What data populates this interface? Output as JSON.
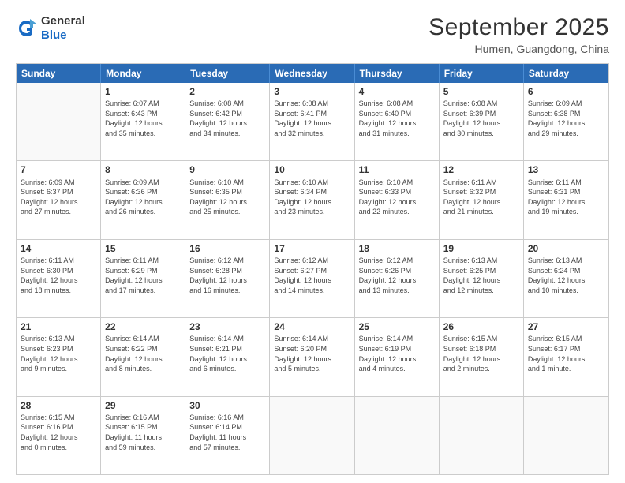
{
  "header": {
    "logo": {
      "general": "General",
      "blue": "Blue"
    },
    "title": "September 2025",
    "location": "Humen, Guangdong, China"
  },
  "calendar": {
    "weekdays": [
      "Sunday",
      "Monday",
      "Tuesday",
      "Wednesday",
      "Thursday",
      "Friday",
      "Saturday"
    ],
    "weeks": [
      [
        {
          "day": "",
          "info": ""
        },
        {
          "day": "1",
          "info": "Sunrise: 6:07 AM\nSunset: 6:43 PM\nDaylight: 12 hours\nand 35 minutes."
        },
        {
          "day": "2",
          "info": "Sunrise: 6:08 AM\nSunset: 6:42 PM\nDaylight: 12 hours\nand 34 minutes."
        },
        {
          "day": "3",
          "info": "Sunrise: 6:08 AM\nSunset: 6:41 PM\nDaylight: 12 hours\nand 32 minutes."
        },
        {
          "day": "4",
          "info": "Sunrise: 6:08 AM\nSunset: 6:40 PM\nDaylight: 12 hours\nand 31 minutes."
        },
        {
          "day": "5",
          "info": "Sunrise: 6:08 AM\nSunset: 6:39 PM\nDaylight: 12 hours\nand 30 minutes."
        },
        {
          "day": "6",
          "info": "Sunrise: 6:09 AM\nSunset: 6:38 PM\nDaylight: 12 hours\nand 29 minutes."
        }
      ],
      [
        {
          "day": "7",
          "info": "Sunrise: 6:09 AM\nSunset: 6:37 PM\nDaylight: 12 hours\nand 27 minutes."
        },
        {
          "day": "8",
          "info": "Sunrise: 6:09 AM\nSunset: 6:36 PM\nDaylight: 12 hours\nand 26 minutes."
        },
        {
          "day": "9",
          "info": "Sunrise: 6:10 AM\nSunset: 6:35 PM\nDaylight: 12 hours\nand 25 minutes."
        },
        {
          "day": "10",
          "info": "Sunrise: 6:10 AM\nSunset: 6:34 PM\nDaylight: 12 hours\nand 23 minutes."
        },
        {
          "day": "11",
          "info": "Sunrise: 6:10 AM\nSunset: 6:33 PM\nDaylight: 12 hours\nand 22 minutes."
        },
        {
          "day": "12",
          "info": "Sunrise: 6:11 AM\nSunset: 6:32 PM\nDaylight: 12 hours\nand 21 minutes."
        },
        {
          "day": "13",
          "info": "Sunrise: 6:11 AM\nSunset: 6:31 PM\nDaylight: 12 hours\nand 19 minutes."
        }
      ],
      [
        {
          "day": "14",
          "info": "Sunrise: 6:11 AM\nSunset: 6:30 PM\nDaylight: 12 hours\nand 18 minutes."
        },
        {
          "day": "15",
          "info": "Sunrise: 6:11 AM\nSunset: 6:29 PM\nDaylight: 12 hours\nand 17 minutes."
        },
        {
          "day": "16",
          "info": "Sunrise: 6:12 AM\nSunset: 6:28 PM\nDaylight: 12 hours\nand 16 minutes."
        },
        {
          "day": "17",
          "info": "Sunrise: 6:12 AM\nSunset: 6:27 PM\nDaylight: 12 hours\nand 14 minutes."
        },
        {
          "day": "18",
          "info": "Sunrise: 6:12 AM\nSunset: 6:26 PM\nDaylight: 12 hours\nand 13 minutes."
        },
        {
          "day": "19",
          "info": "Sunrise: 6:13 AM\nSunset: 6:25 PM\nDaylight: 12 hours\nand 12 minutes."
        },
        {
          "day": "20",
          "info": "Sunrise: 6:13 AM\nSunset: 6:24 PM\nDaylight: 12 hours\nand 10 minutes."
        }
      ],
      [
        {
          "day": "21",
          "info": "Sunrise: 6:13 AM\nSunset: 6:23 PM\nDaylight: 12 hours\nand 9 minutes."
        },
        {
          "day": "22",
          "info": "Sunrise: 6:14 AM\nSunset: 6:22 PM\nDaylight: 12 hours\nand 8 minutes."
        },
        {
          "day": "23",
          "info": "Sunrise: 6:14 AM\nSunset: 6:21 PM\nDaylight: 12 hours\nand 6 minutes."
        },
        {
          "day": "24",
          "info": "Sunrise: 6:14 AM\nSunset: 6:20 PM\nDaylight: 12 hours\nand 5 minutes."
        },
        {
          "day": "25",
          "info": "Sunrise: 6:14 AM\nSunset: 6:19 PM\nDaylight: 12 hours\nand 4 minutes."
        },
        {
          "day": "26",
          "info": "Sunrise: 6:15 AM\nSunset: 6:18 PM\nDaylight: 12 hours\nand 2 minutes."
        },
        {
          "day": "27",
          "info": "Sunrise: 6:15 AM\nSunset: 6:17 PM\nDaylight: 12 hours\nand 1 minute."
        }
      ],
      [
        {
          "day": "28",
          "info": "Sunrise: 6:15 AM\nSunset: 6:16 PM\nDaylight: 12 hours\nand 0 minutes."
        },
        {
          "day": "29",
          "info": "Sunrise: 6:16 AM\nSunset: 6:15 PM\nDaylight: 11 hours\nand 59 minutes."
        },
        {
          "day": "30",
          "info": "Sunrise: 6:16 AM\nSunset: 6:14 PM\nDaylight: 11 hours\nand 57 minutes."
        },
        {
          "day": "",
          "info": ""
        },
        {
          "day": "",
          "info": ""
        },
        {
          "day": "",
          "info": ""
        },
        {
          "day": "",
          "info": ""
        }
      ]
    ]
  }
}
